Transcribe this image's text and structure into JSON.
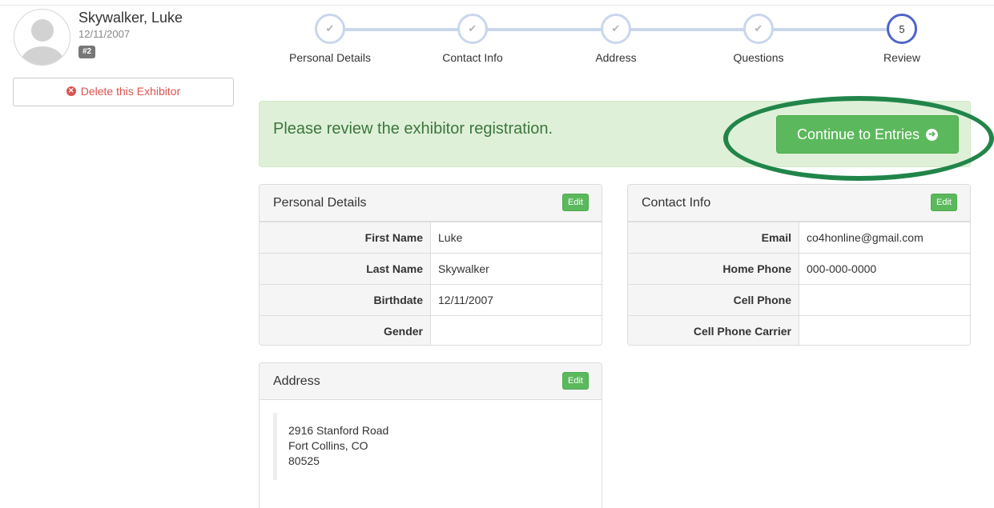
{
  "profile": {
    "name": "Skywalker, Luke",
    "birthdate": "12/11/2007",
    "badge": "#2",
    "delete_label": "Delete this Exhibitor"
  },
  "wizard": {
    "steps": [
      {
        "label": "Personal Details",
        "state": "complete"
      },
      {
        "label": "Contact Info",
        "state": "complete"
      },
      {
        "label": "Address",
        "state": "complete"
      },
      {
        "label": "Questions",
        "state": "complete"
      },
      {
        "label": "Review",
        "state": "active",
        "number": "5"
      }
    ]
  },
  "alert": {
    "message": "Please review the exhibitor registration.",
    "continue_label": "Continue to Entries"
  },
  "personal": {
    "title": "Personal Details",
    "edit_label": "Edit",
    "rows": [
      {
        "label": "First Name",
        "value": "Luke"
      },
      {
        "label": "Last Name",
        "value": "Skywalker"
      },
      {
        "label": "Birthdate",
        "value": "12/11/2007"
      },
      {
        "label": "Gender",
        "value": ""
      }
    ]
  },
  "contact": {
    "title": "Contact Info",
    "edit_label": "Edit",
    "rows": [
      {
        "label": "Email",
        "value": "co4honline@gmail.com"
      },
      {
        "label": "Home Phone",
        "value": "000-000-0000"
      },
      {
        "label": "Cell Phone",
        "value": ""
      },
      {
        "label": "Cell Phone Carrier",
        "value": ""
      }
    ]
  },
  "address": {
    "title": "Address",
    "edit_label": "Edit",
    "line1": "2916 Stanford Road",
    "line2": "Fort Collins, CO",
    "line3": "80525"
  },
  "colors": {
    "success": "#5cb85c",
    "alert_bg": "#dff0d8",
    "alert_text": "#3c763d",
    "danger": "#d9534f",
    "step_active": "#4e64c8",
    "step_line": "#c9d6ec",
    "highlight_ring": "#21854a"
  }
}
